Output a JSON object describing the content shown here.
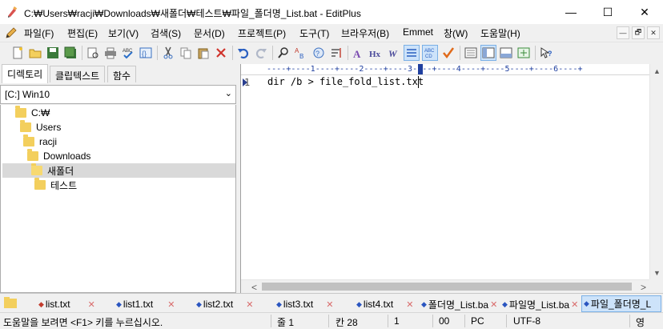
{
  "window": {
    "title": "C:₩Users₩racji₩Downloads₩새폴더₩테스트₩파일_폴더명_List.bat - EditPlus",
    "minimize": "—",
    "maximize": "☐",
    "close": "✕"
  },
  "menu": {
    "items": [
      "파일(F)",
      "편집(E)",
      "보기(V)",
      "검색(S)",
      "문서(D)",
      "프로젝트(P)",
      "도구(T)",
      "브라우저(B)",
      "Emmet",
      "창(W)",
      "도움말(H)"
    ],
    "mdi_buttons": [
      "—",
      "🗗",
      "✕"
    ]
  },
  "toolbar": {
    "icons": [
      "new-file-icon",
      "open-file-icon",
      "save-icon",
      "save-all-icon",
      "print-preview-icon",
      "print-icon",
      "spell-check-icon",
      "browser-preview-icon",
      "cut-icon",
      "copy-icon",
      "paste-icon",
      "delete-icon",
      "undo-icon",
      "redo-icon",
      "find-icon",
      "replace-icon",
      "goto-icon",
      "word-wrap-icon",
      "font-size-icon",
      "heading-icon",
      "bold-italic-icon",
      "line-number-icon",
      "ruler-icon",
      "spell-icon",
      "view-full-icon",
      "view-sidebar-icon",
      "view-output-icon",
      "view-browser-icon",
      "help-icon"
    ]
  },
  "left_panel": {
    "tabs": [
      "디렉토리",
      "클립텍스트",
      "함수"
    ],
    "drive": "[C:] Win10",
    "tree": [
      {
        "label": "C:₩",
        "level": 0,
        "selected": false
      },
      {
        "label": "Users",
        "level": 1,
        "selected": false
      },
      {
        "label": "racji",
        "level": 2,
        "selected": false
      },
      {
        "label": "Downloads",
        "level": 3,
        "selected": false
      },
      {
        "label": "새폴더",
        "level": 4,
        "selected": true
      },
      {
        "label": "테스트",
        "level": 5,
        "selected": false
      }
    ]
  },
  "editor": {
    "ruler": "----+----1----+----2----+----3----+----4----+----5----+----6----+",
    "line_number": "1",
    "code": "dir /b > file_fold_list.txt"
  },
  "doc_tabs": [
    {
      "label": "list.txt",
      "active": false
    },
    {
      "label": "list1.txt",
      "active": false
    },
    {
      "label": "list2.txt",
      "active": false
    },
    {
      "label": "list3.txt",
      "active": false
    },
    {
      "label": "list4.txt",
      "active": false
    },
    {
      "label": "폴더명_List.ba",
      "active": false
    },
    {
      "label": "파일명_List.ba",
      "active": false
    },
    {
      "label": "파일_폴더명_L",
      "active": true
    }
  ],
  "status": {
    "help": "도움말을 보려면 <F1> 키를 누르십시오.",
    "line": "줄 1",
    "col": "칸 28",
    "sel": "1",
    "ovr": "00",
    "eol": "PC",
    "enc": "UTF-8",
    "lang": "영"
  },
  "colors": {
    "accent": "#1f3f9f",
    "selection": "#cde3fa",
    "folder": "#f3cf5d"
  }
}
